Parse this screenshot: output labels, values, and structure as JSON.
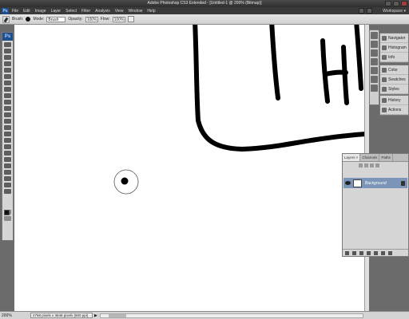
{
  "app": {
    "title": "Adobe Photoshop CS3 Extended - [Untitled-1 @ 200% (Bitmap)]"
  },
  "menu": {
    "logo": "Ps",
    "items": [
      "File",
      "Edit",
      "Image",
      "Layer",
      "Select",
      "Filter",
      "Analysis",
      "View",
      "Window",
      "Help"
    ],
    "workspace_label": "Workspace ▾"
  },
  "options": {
    "brush_label": "Brush:",
    "mode_label": "Mode:",
    "mode_value": "Brush",
    "opacity_label": "Opacity:",
    "opacity_value": "100%",
    "flow_label": "Flow:",
    "flow_value": "100%"
  },
  "toolbox": {
    "logo": "Ps"
  },
  "panels": {
    "stack_top": [
      {
        "label": "Navigator",
        "icon": "navigator-icon"
      },
      {
        "label": "Histogram",
        "icon": "histogram-icon"
      },
      {
        "label": "Info",
        "icon": "info-icon"
      }
    ],
    "stack_mid": [
      {
        "label": "Color",
        "icon": "color-icon"
      },
      {
        "label": "Swatches",
        "icon": "swatches-icon"
      },
      {
        "label": "Styles",
        "icon": "styles-icon"
      }
    ],
    "stack_bottom": [
      {
        "label": "History",
        "icon": "history-icon"
      },
      {
        "label": "Actions",
        "icon": "actions-icon"
      }
    ]
  },
  "layers": {
    "tabs": [
      "Layers ×",
      "Channels",
      "Paths"
    ],
    "layer_name": "Background"
  },
  "status": {
    "zoom": "200%",
    "doc_info": "4768 pixels x 3648 pixels (600 ppi)",
    "arrow": "▶"
  },
  "colors": {
    "canvas": "#ffffff",
    "chrome_dark": "#3a3a3a",
    "layer_selected": "#7b95b8",
    "ink": "#000000"
  }
}
